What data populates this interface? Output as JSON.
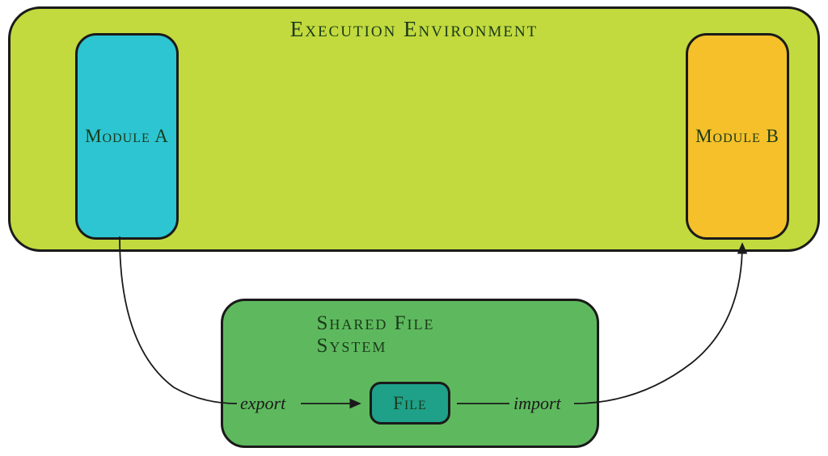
{
  "exec_env": {
    "title": "Execution Environment",
    "module_a": "Module A",
    "module_b": "Module B"
  },
  "file_system": {
    "title": "Shared File System",
    "file": "File"
  },
  "labels": {
    "export": "export",
    "import": "import"
  }
}
